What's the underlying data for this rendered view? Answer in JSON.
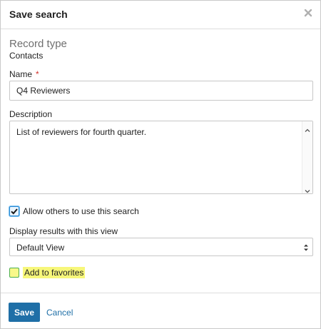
{
  "dialog": {
    "title": "Save search",
    "close_icon": "close-icon"
  },
  "record_type": {
    "heading": "Record type",
    "value": "Contacts"
  },
  "name_field": {
    "label": "Name",
    "required_marker": "*",
    "value": "Q4 Reviewers"
  },
  "description_field": {
    "label": "Description",
    "value": "List of reviewers for fourth quarter."
  },
  "allow_others": {
    "label": "Allow others to use this search",
    "checked": true
  },
  "display_view": {
    "label": "Display results with this view",
    "selected": "Default View"
  },
  "favorites": {
    "label": "Add to favorites",
    "checked": false
  },
  "footer": {
    "save_label": "Save",
    "cancel_label": "Cancel"
  },
  "colors": {
    "primary": "#1f6fa7",
    "required": "#d2302a",
    "highlight": "#f7f77a",
    "checkbox_border": "#2b8ad4",
    "favorites_border": "#4caf50"
  }
}
